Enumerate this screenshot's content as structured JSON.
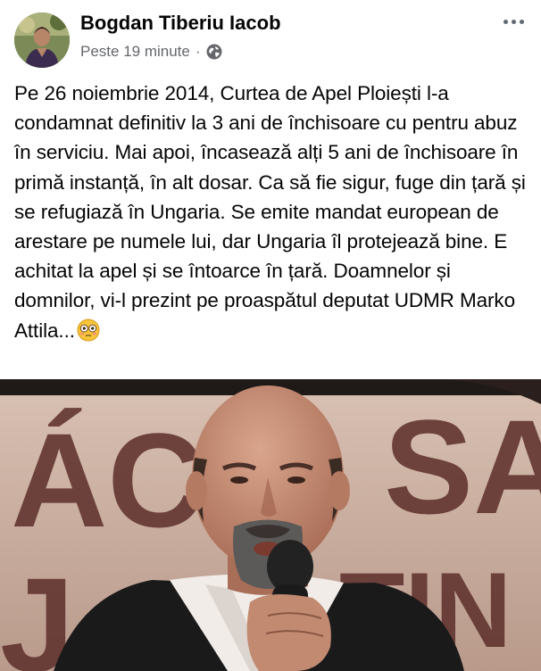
{
  "post": {
    "author_name": "Bogdan Tiberiu Iacob",
    "timestamp": "Peste 19 minute",
    "separator": "·",
    "privacy_icon": "globe-icon",
    "more_icon": "more-options-icon",
    "body_text": "Pe 26 noiembrie 2014, Curtea de Apel Ploiești l-a condamnat definitiv la 3 ani de închisoare cu pentru abuz în serviciu. Mai apoi, încasează alți 5 ani de închisoare în primă instanță, în alt dosar. Ca să fie sigur, fuge din țară și se refugiază în Ungaria. Se emite mandat european de arestare pe numele lui, dar Ungaria îl protejează bine. E achitat la apel și se întoarce în țară. Doamnelor și domnilor, vi-l prezint pe proaspătul deputat UDMR Marko Attila...",
    "emoji_icon": "flushed-face-emoji-icon",
    "photo_banner_text": "ÁCSA TIN"
  },
  "colors": {
    "text": "#050505",
    "secondary_text": "#65676b",
    "banner_background": "#c8aa9b",
    "banner_letters": "#5a2f2a"
  }
}
